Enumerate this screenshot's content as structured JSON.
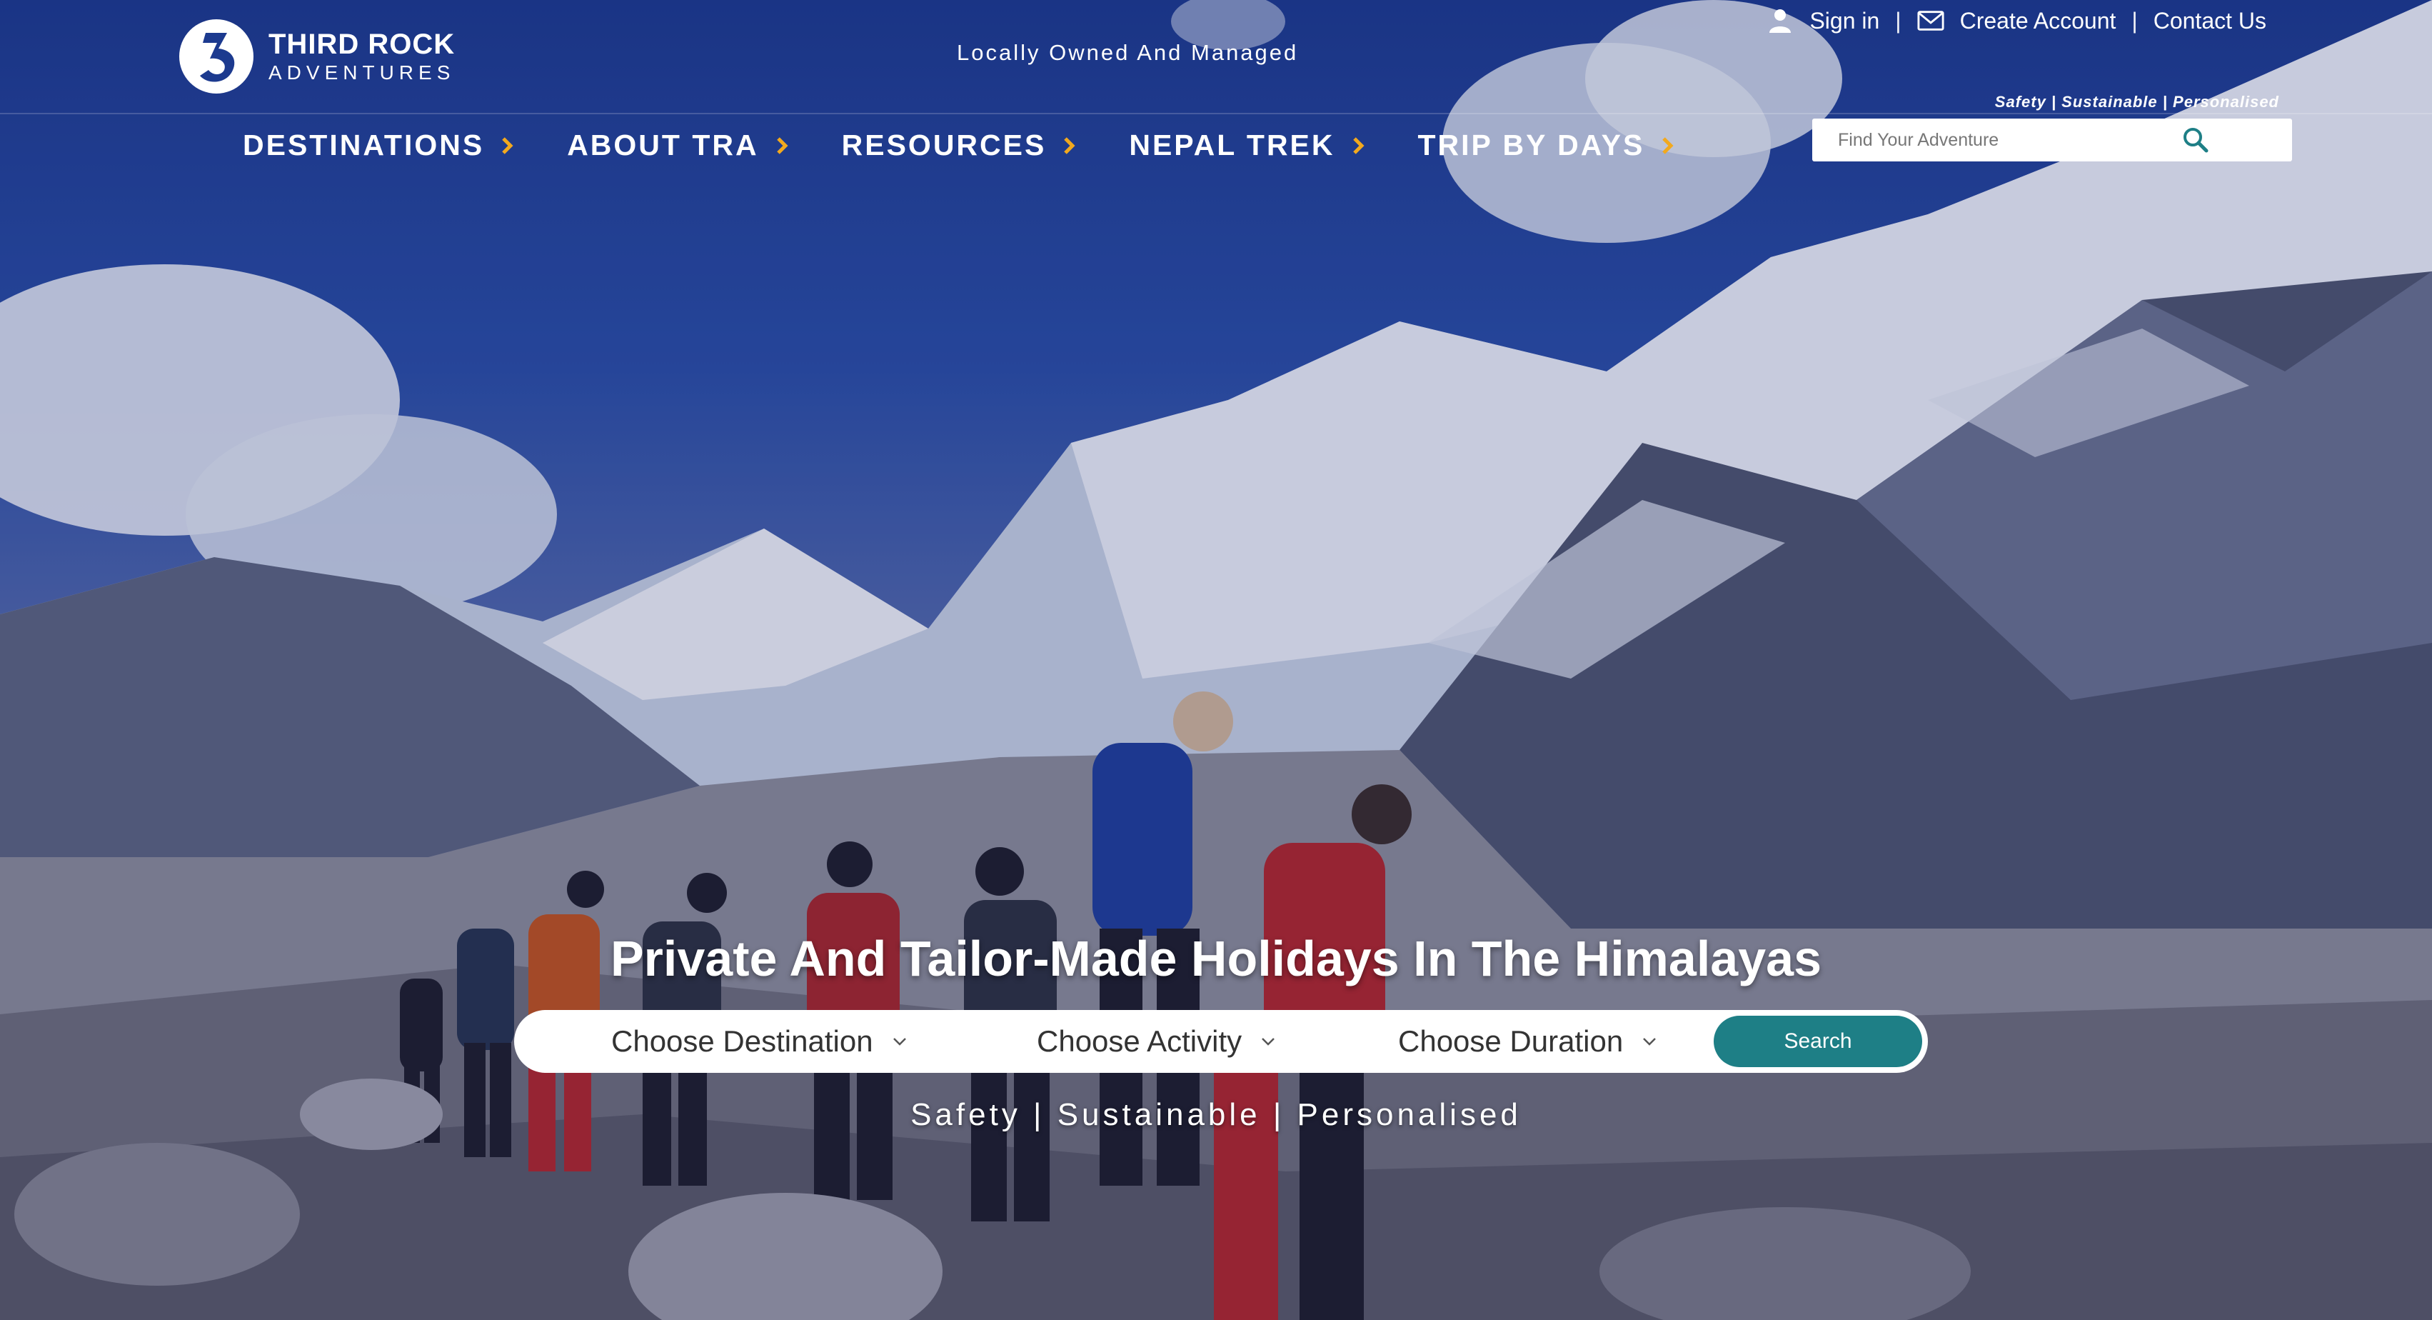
{
  "brand": {
    "name_line1": "THIRD ROCK",
    "name_line2": "ADVENTURES",
    "tagline": "Locally Owned And Managed"
  },
  "top_links": {
    "sign_in": "Sign in",
    "separator": "|",
    "create_account": "Create Account",
    "contact_us": "Contact Us"
  },
  "search": {
    "motto": "Safety | Sustainable | Personalised",
    "placeholder": "Find Your Adventure"
  },
  "nav": {
    "items": [
      {
        "label": "DESTINATIONS"
      },
      {
        "label": "ABOUT TRA"
      },
      {
        "label": "RESOURCES"
      },
      {
        "label": "NEPAL TREK"
      },
      {
        "label": "TRIP BY DAYS"
      }
    ]
  },
  "hero": {
    "title": "Private And Tailor-Made Holidays In The Himalayas",
    "finder": {
      "destination": "Choose Destination",
      "activity": "Choose Activity",
      "duration": "Choose Duration",
      "button": "Search"
    },
    "motto": "Safety | Sustainable | Personalised"
  },
  "colors": {
    "accent_chevron": "#f2a91e",
    "search_button": "#1e7f86",
    "search_icon": "#1e7f86"
  }
}
